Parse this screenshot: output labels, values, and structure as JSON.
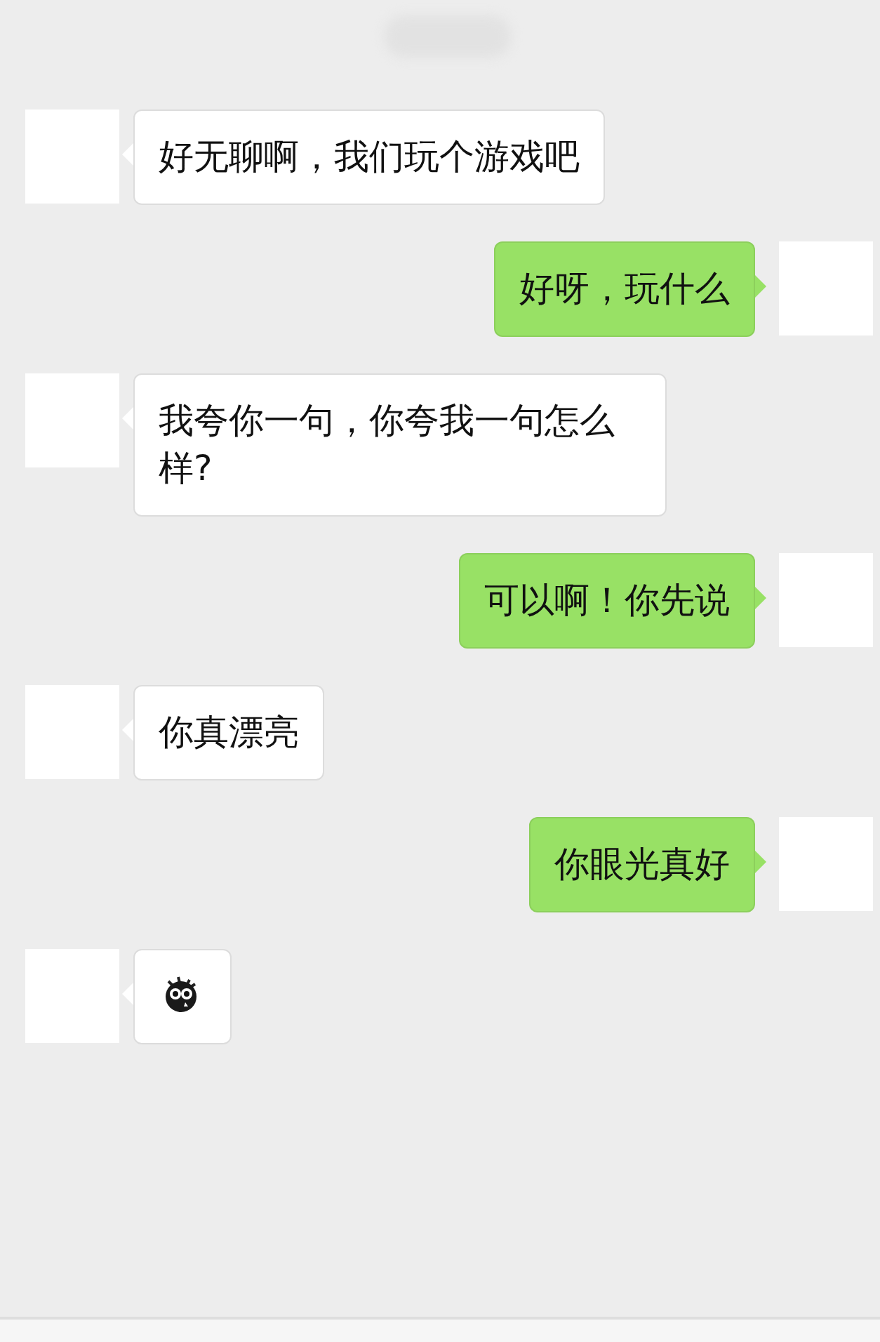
{
  "messages": [
    {
      "outgoing": false,
      "kind": "text",
      "text": "好无聊啊，我们玩个游戏吧"
    },
    {
      "outgoing": true,
      "kind": "text",
      "text": "好呀，玩什么"
    },
    {
      "outgoing": false,
      "kind": "text",
      "text": "我夸你一句，你夸我一句怎么样?"
    },
    {
      "outgoing": true,
      "kind": "text",
      "text": "可以啊！你先说"
    },
    {
      "outgoing": false,
      "kind": "text",
      "text": "你真漂亮"
    },
    {
      "outgoing": true,
      "kind": "text",
      "text": "你眼光真好"
    },
    {
      "outgoing": false,
      "kind": "emoji"
    }
  ]
}
